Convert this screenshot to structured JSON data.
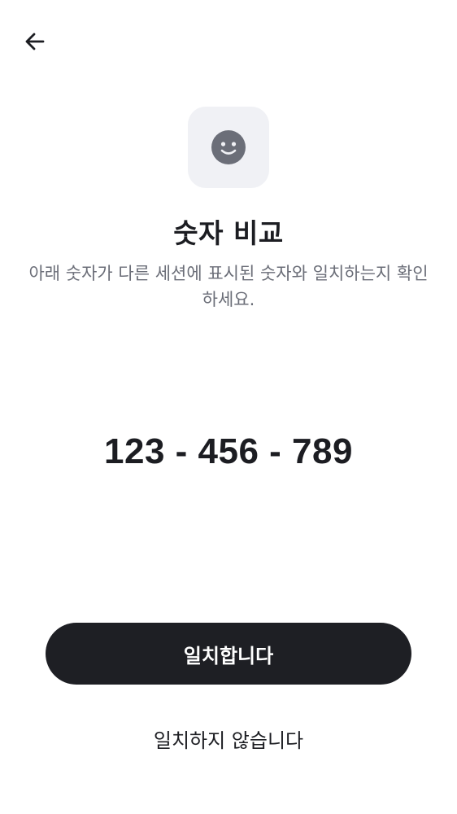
{
  "header": {
    "back_icon": "arrow-left-icon"
  },
  "hero": {
    "icon": "smiley-face-icon",
    "title": "숫자 비교",
    "description": "아래 숫자가 다른 세션에 표시된 숫자와 일치하는지 확인하세요."
  },
  "code": {
    "value": "123 - 456 - 789"
  },
  "actions": {
    "confirm_label": "일치합니다",
    "reject_label": "일치하지 않습니다"
  },
  "colors": {
    "primary_button_bg": "#1e1f24",
    "icon_tile_bg": "#f0f1f5",
    "icon_color": "#6b6e78",
    "text_primary": "#1c1d22",
    "text_secondary": "#6b6e78"
  }
}
